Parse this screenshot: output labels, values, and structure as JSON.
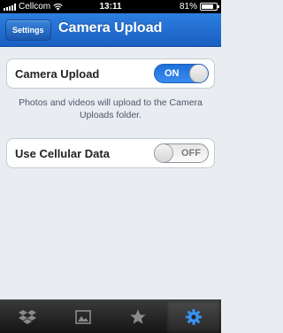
{
  "status_bar": {
    "carrier": "Cellcom",
    "time": "13:11",
    "battery_percent": "81%",
    "battery_level": 0.81,
    "icons": [
      "signal-icon",
      "wifi-icon",
      "battery-icon"
    ]
  },
  "nav": {
    "back_label": "Settings",
    "title": "Camera Upload"
  },
  "settings": {
    "camera_upload": {
      "label": "Camera Upload",
      "state": "ON",
      "on": true
    },
    "description": "Photos and videos will upload to the Camera Uploads folder.",
    "cellular_data": {
      "label": "Use Cellular Data",
      "state": "OFF",
      "on": false
    }
  },
  "tabs": [
    {
      "icon": "dropbox-icon",
      "active": false
    },
    {
      "icon": "photos-icon",
      "active": false
    },
    {
      "icon": "favorites-star-icon",
      "active": false
    },
    {
      "icon": "settings-gear-icon",
      "active": true
    }
  ],
  "colors": {
    "nav_blue": "#1a5fc2",
    "toggle_on_blue": "#2a7ee8",
    "background": "#e9edf1"
  }
}
